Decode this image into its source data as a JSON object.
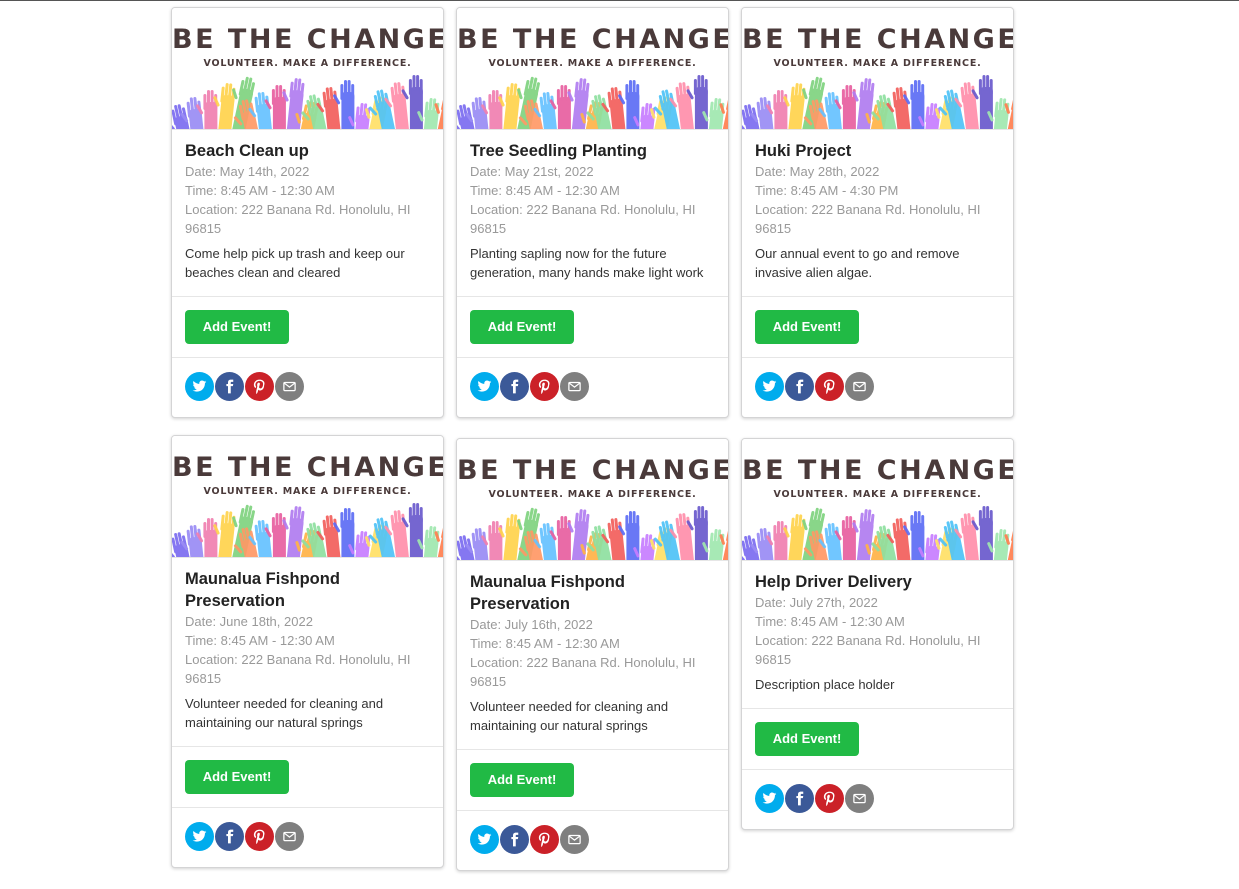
{
  "banner": {
    "title": "BE THE CHANGE",
    "subtitle": "VOLUNTEER. MAKE A DIFFERENCE."
  },
  "colors": {
    "add_button": "#21ba45",
    "twitter": "#00aced",
    "facebook": "#3b5998",
    "pinterest": "#cb2128",
    "email": "#7f7f7f"
  },
  "share_icons": [
    "twitter-icon",
    "facebook-icon",
    "pinterest-icon",
    "email-icon"
  ],
  "events": [
    {
      "title": "Beach Clean up",
      "date": "Date: May 14th, 2022",
      "time": "Time: 8:45 AM - 12:30 AM",
      "location": "Location: 222 Banana Rd. Honolulu, HI 96815",
      "description": "Come help pick up trash and keep our beaches clean and cleared",
      "button": "Add Event!"
    },
    {
      "title": "Tree Seedling Planting",
      "date": "Date: May 21st, 2022",
      "time": "Time: 8:45 AM - 12:30 AM",
      "location": "Location: 222 Banana Rd. Honolulu, HI 96815",
      "description": "Planting sapling now for the future generation, many hands make light work",
      "button": "Add Event!"
    },
    {
      "title": "Huki Project",
      "date": "Date: May 28th, 2022",
      "time": "Time: 8:45 AM - 4:30 PM",
      "location": "Location: 222 Banana Rd. Honolulu, HI 96815",
      "description": "Our annual event to go and remove invasive alien algae.",
      "button": "Add Event!"
    },
    {
      "title": "Maunalua Fishpond Preservation",
      "date": "Date: June 18th, 2022",
      "time": "Time: 8:45 AM - 12:30 AM",
      "location": "Location: 222 Banana Rd. Honolulu, HI 96815",
      "description": "Volunteer needed for cleaning and maintaining our natural springs",
      "button": "Add Event!"
    },
    {
      "title": "Maunalua Fishpond Preservation",
      "date": "Date: July 16th, 2022",
      "time": "Time: 8:45 AM - 12:30 AM",
      "location": "Location: 222 Banana Rd. Honolulu, HI 96815",
      "description": "Volunteer needed for cleaning and maintaining our natural springs",
      "button": "Add Event!"
    },
    {
      "title": "Help Driver Delivery",
      "date": "Date: July 27th, 2022",
      "time": "Time: 8:45 AM - 12:30 AM",
      "location": "Location: 222 Banana Rd. Honolulu, HI 96815",
      "description": "Description place holder",
      "button": "Add Event!"
    }
  ]
}
